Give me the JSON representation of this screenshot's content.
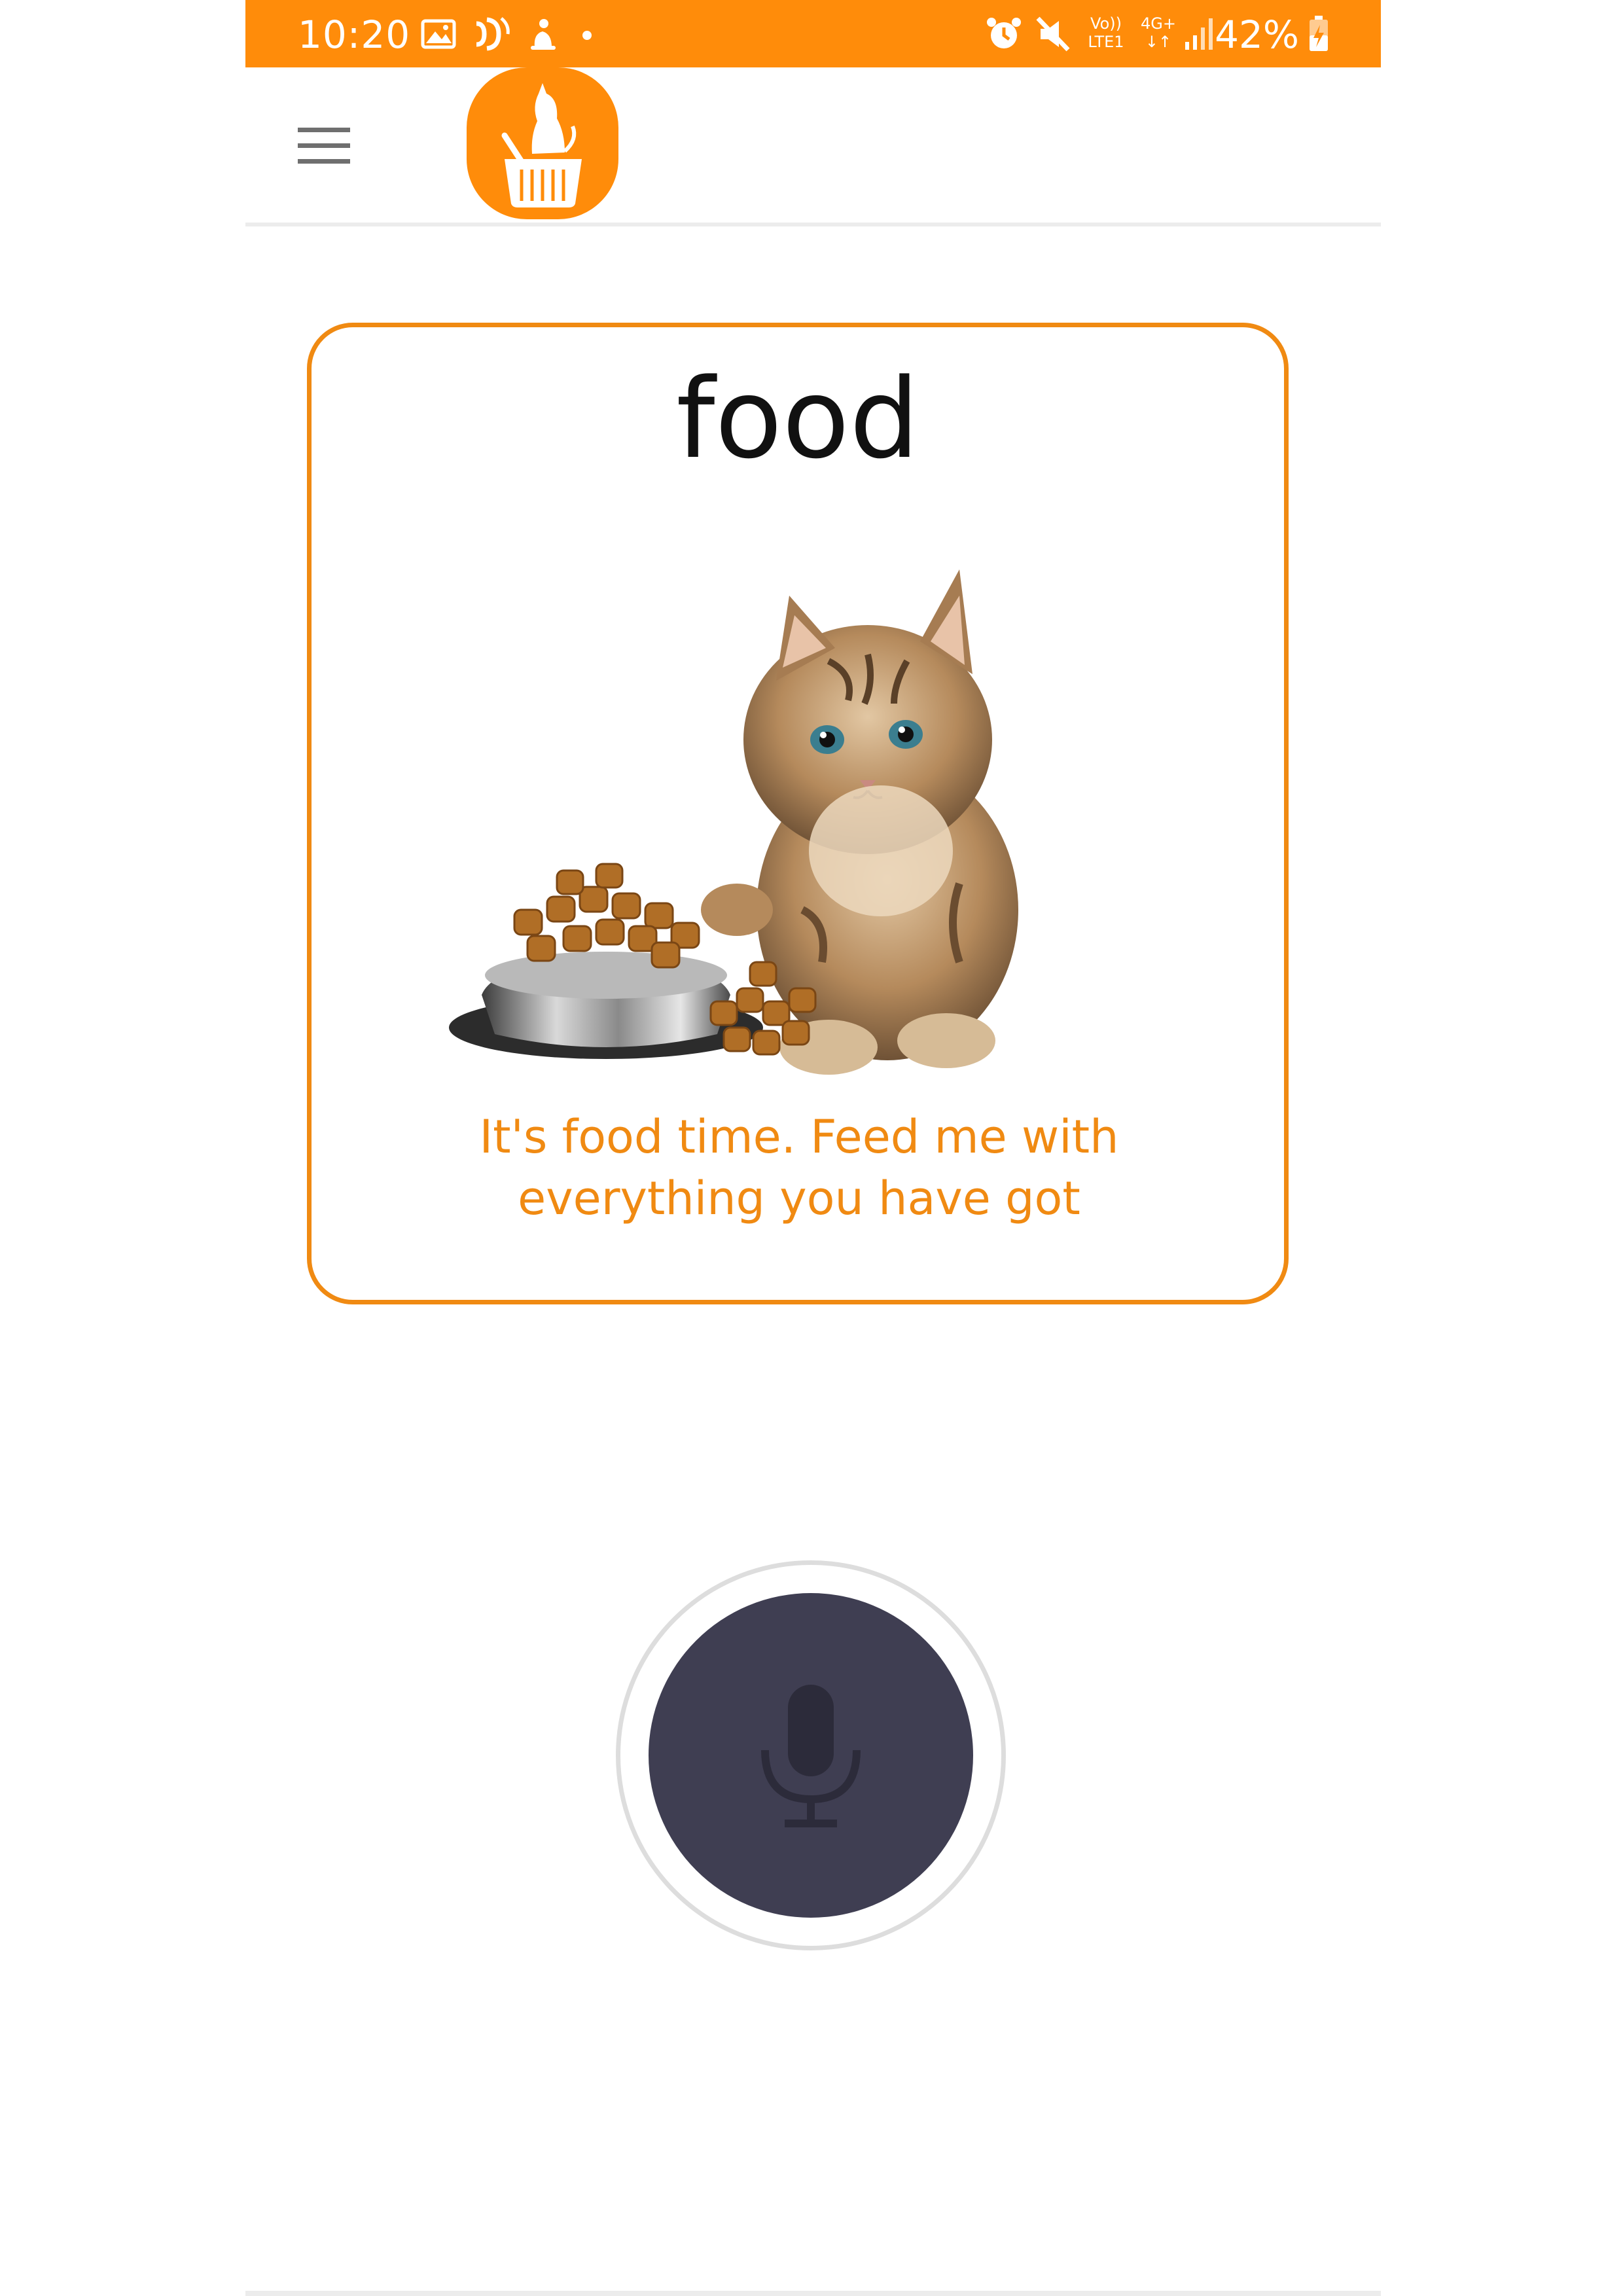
{
  "status_bar": {
    "time": "10:20",
    "battery": "42%",
    "network_top": "Vo))",
    "network_bottom": "LTE1",
    "network_type": "4G+",
    "icons": [
      "gallery-icon",
      "nfc-icon",
      "notification-icon",
      "dot-icon",
      "alarm-icon",
      "mute-icon",
      "volte-icon",
      "data-arrows-icon",
      "signal-icon",
      "battery-icon"
    ],
    "color": "#ff8c0a"
  },
  "app_bar": {
    "menu_icon": "hamburger-menu-icon",
    "logo": "cat-basket-logo"
  },
  "card": {
    "title": "food",
    "illustration": "kitten-with-food-bowl",
    "caption": "It's food time. Feed me with everything you have got",
    "accent_color": "#f08a12"
  },
  "mic_button": {
    "icon": "microphone-icon",
    "color": "#3f3e52"
  }
}
